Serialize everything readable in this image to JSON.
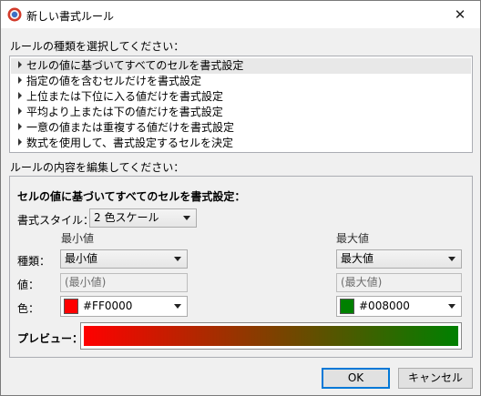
{
  "window": {
    "title": "新しい書式ルール",
    "close_glyph": "✕"
  },
  "rule_type": {
    "label": "ルールの種類を選択してください：",
    "items": [
      "セルの値に基づいてすべてのセルを書式設定",
      "指定の値を含むセルだけを書式設定",
      "上位または下位に入る値だけを書式設定",
      "平均より上または下の値だけを書式設定",
      "一意の値または重複する値だけを書式設定",
      "数式を使用して、書式設定するセルを決定"
    ],
    "selected_index": 0
  },
  "edit": {
    "label": "ルールの内容を編集してください：",
    "heading": "セルの値に基づいてすべてのセルを書式設定：",
    "style_label": "書式スタイル：",
    "style_value": "2 色スケール",
    "min": {
      "header": "最小値",
      "type_value": "最小値",
      "value_placeholder": "(最小値)",
      "color_value": "#FF0000",
      "swatch_color": "#ff0000"
    },
    "max": {
      "header": "最大値",
      "type_value": "最大値",
      "value_placeholder": "(最大値)",
      "color_value": "#008000",
      "swatch_color": "#008000"
    },
    "row_labels": {
      "type": "種類：",
      "value": "値：",
      "color": "色："
    },
    "preview_label": "プレビュー："
  },
  "buttons": {
    "ok": "OK",
    "cancel": "キャンセル"
  }
}
